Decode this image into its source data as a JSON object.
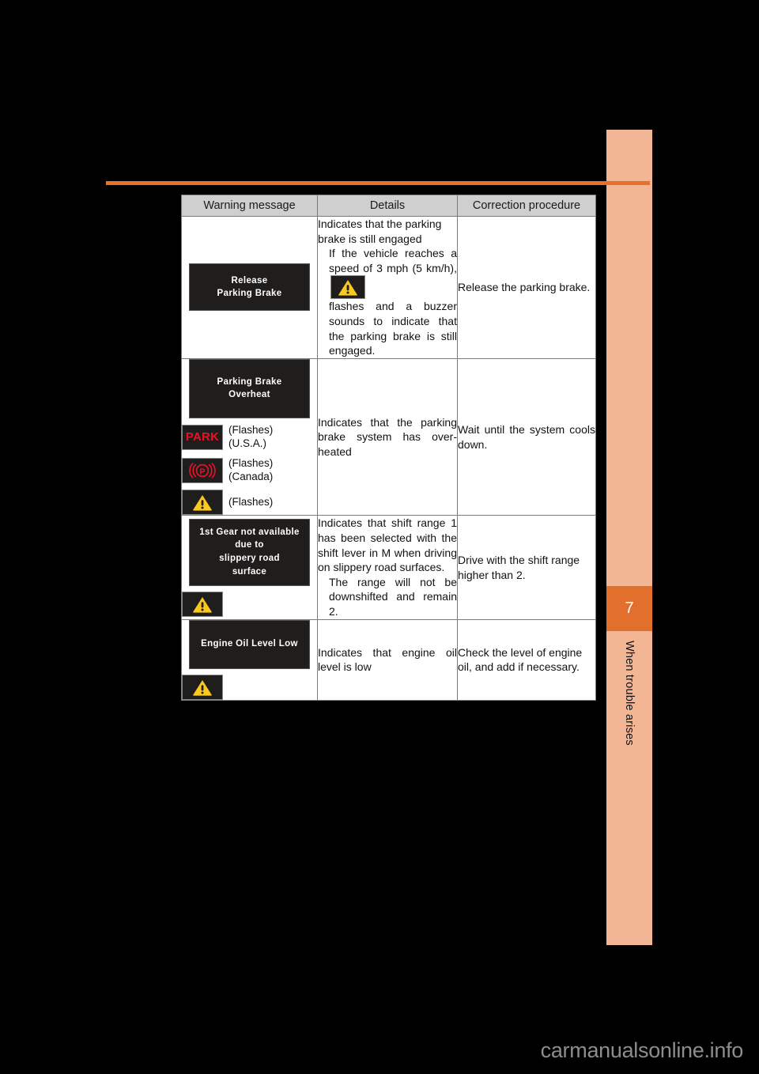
{
  "page": {
    "background_color": "#000000",
    "rule_color": "#e8702a"
  },
  "chapter_tab": {
    "number": "7",
    "title": "When trouble arises",
    "tab_color": "#f2b694",
    "number_box_color": "#e2702c"
  },
  "table": {
    "headers": [
      "Warning message",
      "Details",
      "Correction procedure"
    ],
    "rows": [
      {
        "display_lines": [
          "Release",
          "Parking Brake"
        ],
        "indicators": [],
        "details": {
          "lead": "Indicates that the parking brake is still engaged",
          "sub_before_icon": "If the vehicle reaches a speed of 3 mph (5 km/h),",
          "icon": "warning-triangle-icon",
          "sub_after_icon": "flashes and a buzzer sounds to indicate that the parking brake is still engaged."
        },
        "correction": "Release the parking brake."
      },
      {
        "display_lines": [
          "Parking Brake",
          "Overheat"
        ],
        "indicators": [
          {
            "type": "text",
            "label": "PARK",
            "color": "#e8112a",
            "notes": [
              "(Flashes)",
              "(U.S.A.)"
            ]
          },
          {
            "type": "brake-p-icon",
            "color": "#e8112a",
            "notes": [
              "(Flashes)",
              "(Canada)"
            ]
          },
          {
            "type": "warning-triangle-icon",
            "color": "#fac81e",
            "notes": [
              "(Flashes)"
            ]
          }
        ],
        "details": {
          "lead": "Indicates that the parking brake system has over-heated"
        },
        "correction": "Wait until the system cools down."
      },
      {
        "display_lines": [
          "1st Gear not available",
          "due to",
          "slippery road",
          "surface"
        ],
        "indicators": [
          {
            "type": "warning-triangle-icon",
            "color": "#fac81e",
            "notes": []
          }
        ],
        "details": {
          "lead": "Indicates that shift range 1 has been selected with the shift lever in M when driving on slippery road surfaces.",
          "sub": "The range will not be downshifted and remain 2."
        },
        "correction": "Drive with the shift range higher than 2."
      },
      {
        "display_lines": [
          "Engine Oil Level Low"
        ],
        "indicators": [
          {
            "type": "warning-triangle-icon",
            "color": "#fac81e",
            "notes": []
          }
        ],
        "details": {
          "lead": "Indicates that engine oil level is low"
        },
        "correction": "Check the level of engine oil, and add if necessary."
      }
    ]
  },
  "watermark": {
    "text": "carmanualsonline.info"
  }
}
